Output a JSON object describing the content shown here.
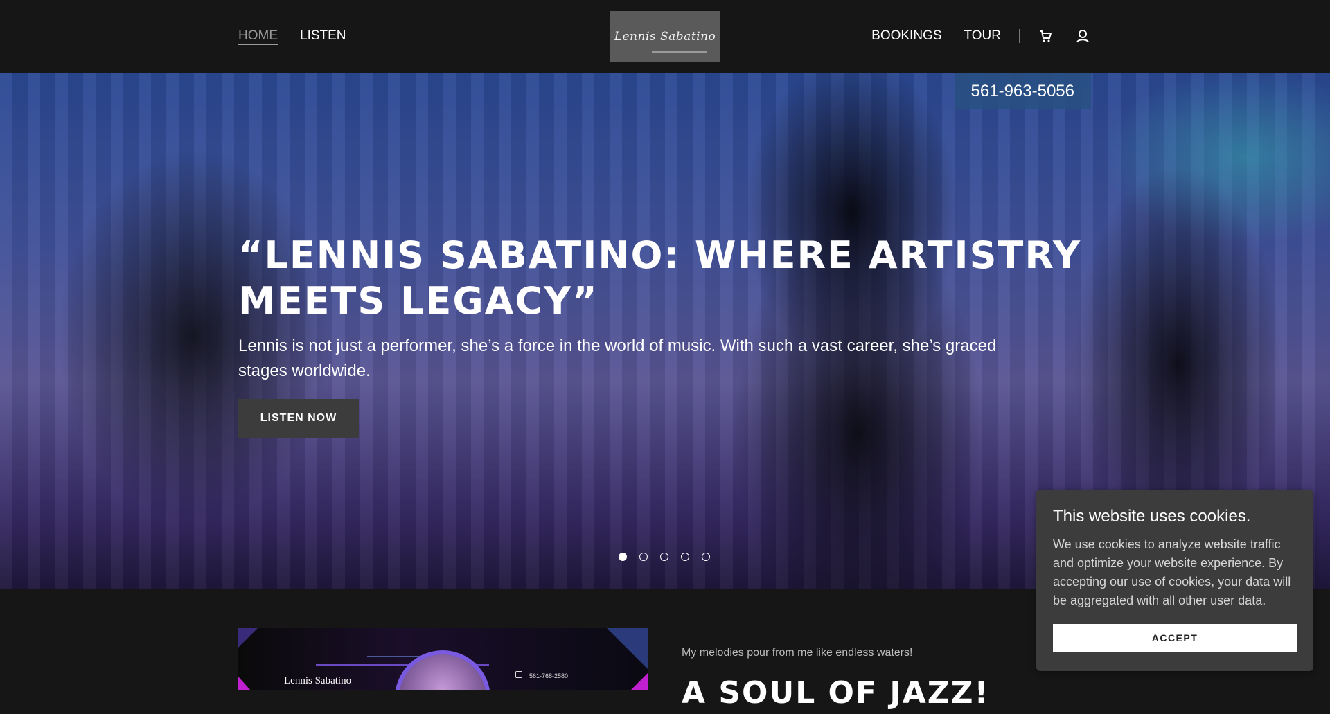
{
  "header": {
    "nav_left": [
      {
        "label": "HOME",
        "active": true
      },
      {
        "label": "LISTEN",
        "active": false
      }
    ],
    "logo_text": "Lennis Sabatino",
    "nav_right": [
      {
        "label": "BOOKINGS"
      },
      {
        "label": "TOUR"
      }
    ],
    "icons": [
      "cart-icon",
      "user-icon"
    ]
  },
  "hero": {
    "phone": "561-963-5056",
    "title": "“LENNIS SABATINO: WHERE ARTISTRY MEETS LEGACY”",
    "subtitle": "Lennis is not just a performer, she’s a force in the world of music. With such a vast career, she’s graced stages worldwide.",
    "cta_label": "LISTEN NOW",
    "slides_total": 5,
    "active_slide": 1
  },
  "section": {
    "promo_name": "Lennis Sabatino",
    "promo_phone": "561-768-2580",
    "tagline": "My melodies pour from me like endless waters!",
    "title": "A SOUL OF JAZZ!"
  },
  "cookie_banner": {
    "title": "This website uses cookies.",
    "text": "We use cookies to analyze website traffic and optimize your website experience. By accepting our use of cookies, your data will be aggregated with all other user data.",
    "accept_label": "ACCEPT"
  }
}
